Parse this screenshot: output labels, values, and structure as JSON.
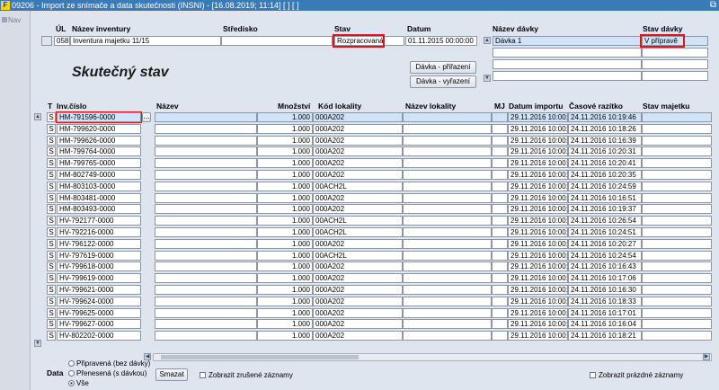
{
  "window": {
    "title": "09206 - Import ze snímače a data skutečnosti (INSNI) - [16.08.2019; 11:14]  [ ]  [ ]"
  },
  "nav": {
    "item": "Nav"
  },
  "top_headers": {
    "ul": "ÚL",
    "nazev_inventury": "Název inventury",
    "stredisko": "Středisko",
    "stav": "Stav",
    "datum": "Datum",
    "nazev_davky": "Název dávky",
    "stav_davky": "Stav dávky"
  },
  "inventory": {
    "ul": "058",
    "name": "Inventura majetku 11/15",
    "stredisko": "",
    "stav": "Rozpracovaná",
    "datum": "01.11.2015 00:00:00"
  },
  "batches": [
    {
      "name": "Dávka 1",
      "status": "V přípravě"
    },
    {
      "name": "",
      "status": ""
    },
    {
      "name": "",
      "status": ""
    },
    {
      "name": "",
      "status": ""
    }
  ],
  "buttons": {
    "davka_prirazeni": "Dávka - přiřazení",
    "davka_vyrazeni": "Dávka - vyřazení",
    "smazat": "Smazat"
  },
  "page_title": "Skutečný stav",
  "columns": {
    "t": "T",
    "inv_cislo": "Inv.číslo",
    "nazev": "Název",
    "mnozstvi": "Množství",
    "kod_lokality": "Kód lokality",
    "nazev_lokality": "Název lokality",
    "mj": "MJ",
    "datum_importu": "Datum importu",
    "casove_razitko": "Časové razítko",
    "stav_majetku": "Stav majetku"
  },
  "rows": [
    {
      "t": "S",
      "inv": "HM-791596-0000",
      "qty": "1.000",
      "kod": "000A202",
      "imp": "29.11.2016 10:00:29",
      "ts": "24.11.2016 10:19:46"
    },
    {
      "t": "S",
      "inv": "HM-799620-0000",
      "qty": "1.000",
      "kod": "000A202",
      "imp": "29.11.2016 10:00:29",
      "ts": "24.11.2016 10:18:26"
    },
    {
      "t": "S",
      "inv": "HM-799626-0000",
      "qty": "1.000",
      "kod": "000A202",
      "imp": "29.11.2016 10:00:29",
      "ts": "24.11.2016 10:16:39"
    },
    {
      "t": "S",
      "inv": "HM-799764-0000",
      "qty": "1.000",
      "kod": "000A202",
      "imp": "29.11.2016 10:00:29",
      "ts": "24.11.2016 10:20:31"
    },
    {
      "t": "S",
      "inv": "HM-799765-0000",
      "qty": "1.000",
      "kod": "000A202",
      "imp": "29.11.2016 10:00:29",
      "ts": "24.11.2016 10:20:41"
    },
    {
      "t": "S",
      "inv": "HM-802749-0000",
      "qty": "1.000",
      "kod": "000A202",
      "imp": "29.11.2016 10:00:29",
      "ts": "24.11.2016 10:20:35"
    },
    {
      "t": "S",
      "inv": "HM-803103-0000",
      "qty": "1.000",
      "kod": "00ACH2L",
      "imp": "29.11.2016 10:00:32",
      "ts": "24.11.2016 10:24:59"
    },
    {
      "t": "S",
      "inv": "HM-803481-0000",
      "qty": "1.000",
      "kod": "000A202",
      "imp": "29.11.2016 10:00:29",
      "ts": "24.11.2016 10:16:51"
    },
    {
      "t": "S",
      "inv": "HM-803493-0000",
      "qty": "1.000",
      "kod": "000A202",
      "imp": "29.11.2016 10:00:29",
      "ts": "24.11.2016 10:19:37"
    },
    {
      "t": "S",
      "inv": "HV-792177-0000",
      "qty": "1.000",
      "kod": "00ACH2L",
      "imp": "29.11.2016 10:00:32",
      "ts": "24.11.2016 10:26:54"
    },
    {
      "t": "S",
      "inv": "HV-792216-0000",
      "qty": "1.000",
      "kod": "00ACH2L",
      "imp": "29.11.2016 10:00:32",
      "ts": "24.11.2016 10:24:51"
    },
    {
      "t": "S",
      "inv": "HV-796122-0000",
      "qty": "1.000",
      "kod": "000A202",
      "imp": "29.11.2016 10:00:29",
      "ts": "24.11.2016 10:20:27"
    },
    {
      "t": "S",
      "inv": "HV-797619-0000",
      "qty": "1.000",
      "kod": "00ACH2L",
      "imp": "29.11.2016 10:00:32",
      "ts": "24.11.2016 10:24:54"
    },
    {
      "t": "S",
      "inv": "HV-799618-0000",
      "qty": "1.000",
      "kod": "000A202",
      "imp": "29.11.2016 10:00:29",
      "ts": "24.11.2016 10:16:43"
    },
    {
      "t": "S",
      "inv": "HV-799619-0000",
      "qty": "1.000",
      "kod": "000A202",
      "imp": "29.11.2016 10:00:29",
      "ts": "24.11.2016 10:17:06"
    },
    {
      "t": "S",
      "inv": "HV-799621-0000",
      "qty": "1.000",
      "kod": "000A202",
      "imp": "29.11.2016 10:00:29",
      "ts": "24.11.2016 10:16:30"
    },
    {
      "t": "S",
      "inv": "HV-799624-0000",
      "qty": "1.000",
      "kod": "000A202",
      "imp": "29.11.2016 10:00:29",
      "ts": "24.11.2016 10:18:33"
    },
    {
      "t": "S",
      "inv": "HV-799625-0000",
      "qty": "1.000",
      "kod": "000A202",
      "imp": "29.11.2016 10:00:29",
      "ts": "24.11.2016 10:17:01"
    },
    {
      "t": "S",
      "inv": "HV-799627-0000",
      "qty": "1.000",
      "kod": "000A202",
      "imp": "29.11.2016 10:00:29",
      "ts": "24.11.2016 10:16:04"
    },
    {
      "t": "S",
      "inv": "HV-802202-0000",
      "qty": "1.000",
      "kod": "000A202",
      "imp": "29.11.2016 10:00:29",
      "ts": "24.11.2016 10:18:21"
    }
  ],
  "filter": {
    "label": "Data",
    "options": [
      "Připravená (bez dávky)",
      "Přenesená (s dávkou)",
      "Vše"
    ],
    "selected": "Vše"
  },
  "checkboxes": {
    "zrusene": "Zobrazit zrušené záznamy",
    "prazdne": "Zobrazit prázdné záznamy"
  }
}
